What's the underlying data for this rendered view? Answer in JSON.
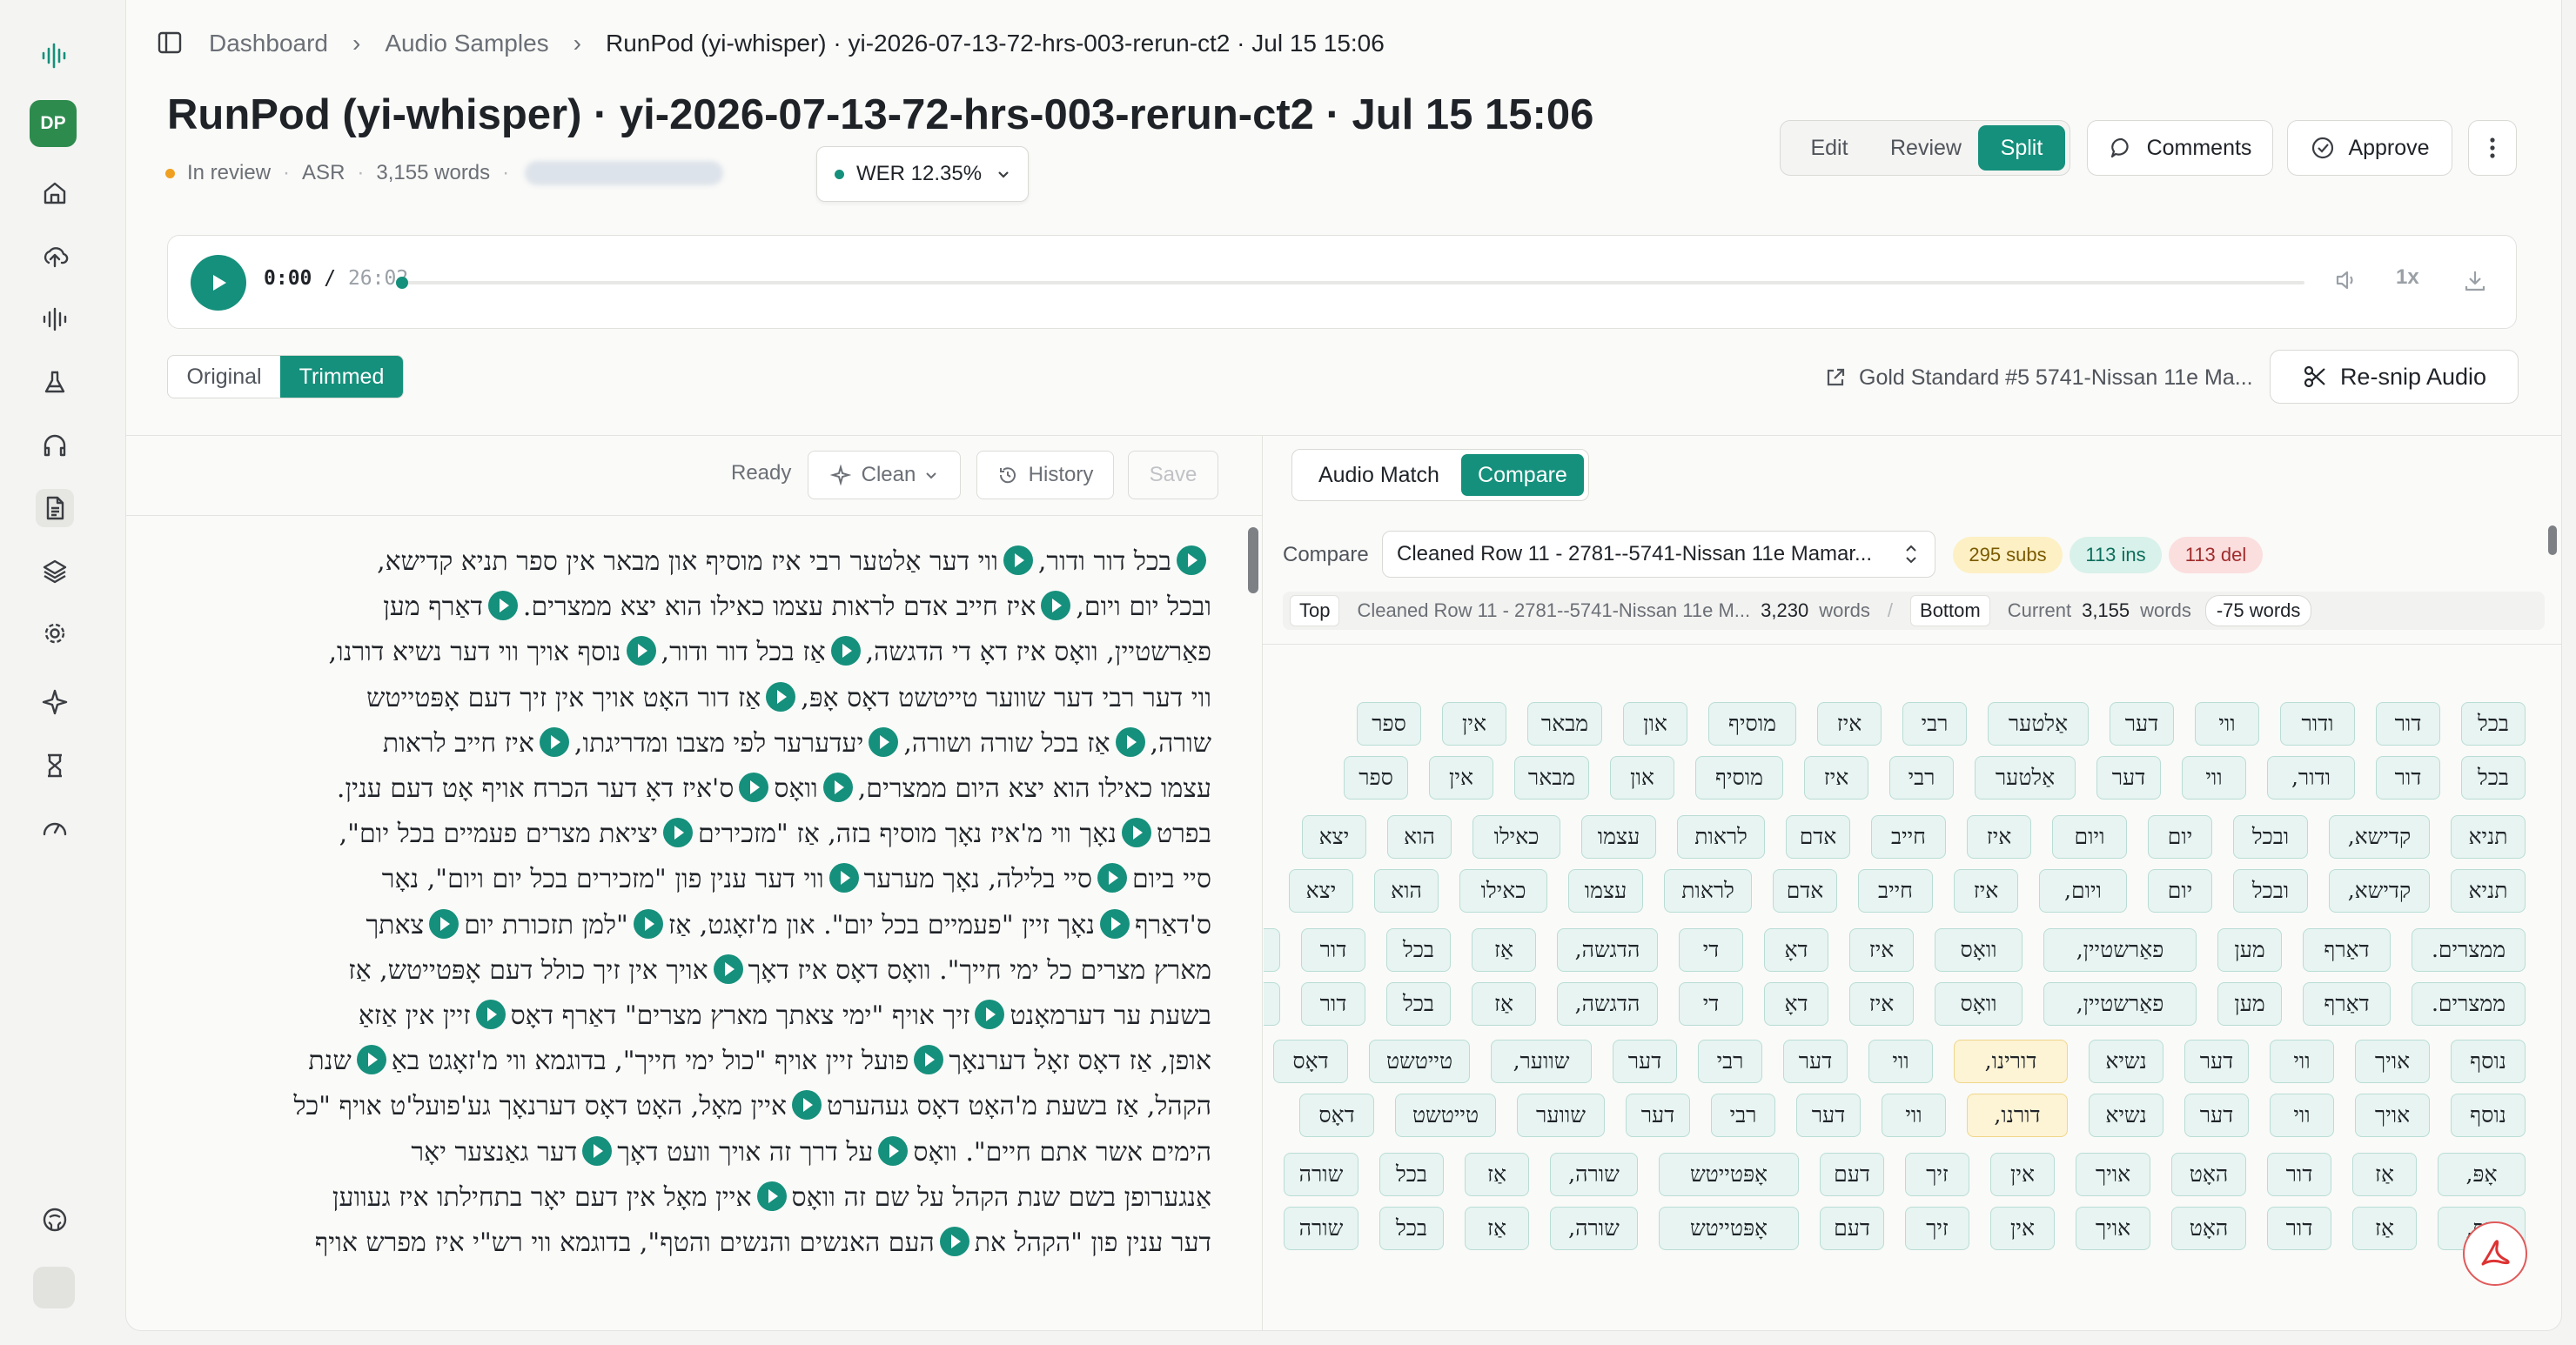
{
  "breadcrumbs": [
    "Dashboard",
    "Audio Samples",
    "RunPod (yi-whisper) · yi-2026-07-13-72-hrs-003-rerun-ct2 · Jul 15 15:06"
  ],
  "title": "RunPod (yi-whisper) · yi-2026-07-13-72-hrs-003-rerun-ct2 · Jul 15 15:06",
  "meta": {
    "status": "In review",
    "type": "ASR",
    "words": "3,155 words",
    "status_color": "#f0a020"
  },
  "wer": {
    "label": "WER 12.35%"
  },
  "modes": [
    "Edit",
    "Review",
    "Split"
  ],
  "active_mode": "Split",
  "header_buttons": {
    "comments": "Comments",
    "approve": "Approve"
  },
  "player": {
    "current": "0:00",
    "duration": "26:02",
    "speed": "1x"
  },
  "version_tabs": [
    "Original",
    "Trimmed"
  ],
  "active_version": "Trimmed",
  "gold_link": "Gold Standard #5 5741-Nissan 11e Ma...",
  "resnip": "Re-snip Audio",
  "editor_toolbar": {
    "status": "Ready",
    "clean": "Clean",
    "history": "History",
    "save": "Save"
  },
  "right_tabs": [
    "Audio Match",
    "Compare"
  ],
  "active_right_tab": "Compare",
  "compare": {
    "label": "Compare",
    "selected": "Cleaned Row 11 - 2781--5741-Nissan 11e Mamar...",
    "subs": "295 subs",
    "ins": "113 ins",
    "del": "113 del",
    "top_tag": "Top",
    "top_name": "Cleaned Row 11 - 2781--5741-Nissan 11e M...",
    "top_count": "3,230",
    "top_unit": "words",
    "bottom_tag": "Bottom",
    "bottom_name": "Current",
    "bottom_count": "3,155",
    "bottom_unit": "words",
    "diff": "-75 words"
  },
  "editor_lines": [
    [
      "בכל דור ודור,",
      "ווי דער אַלטער רבי איז מוסיף און מבאר אין ספר תניא קדישא,"
    ],
    [
      "ובכל יום ויום,",
      "איז חייב אדם לראות עצמו כאילו הוא יצא ממצרים.",
      "דאַרף מען"
    ],
    [
      "פאַרשטיין, וואָס איז דאָ די הדגשה,",
      "אַז בכל דור ודור,",
      "נוסף אויך ווי דער נשיא דורנו,"
    ],
    [
      "ווי דער רבי דער שווער טייטשט דאָס אָפּ,",
      "אַז דור האָט אויך אין זיך דעם אָפּטייטש"
    ],
    [
      "שורה,",
      "אַז בכל שורה ושורה,",
      "יעדערער לפי מצבו ומדריגתו,",
      "איז חייב לראות"
    ],
    [
      "עצמו כאילו הוא יצא היום ממצרים,",
      "וואָס",
      "ס'איז דאָ דער הכרח אויף אָט דעם ענין."
    ],
    [
      "בפרט",
      "נאָך ווי מ'איז נאָך מוסיף בזה, אַז \"מזכירים",
      "יציאת מצרים פעמיים בכל יום\","
    ],
    [
      "סיי ביום",
      "סיי בלילה, נאָך מערער",
      "ווי דער ענין פון \"מזכירים בכל יום ויום\", נאָר"
    ],
    [
      "ס'דאַרף",
      "נאָך זיין \"פעמיים בכל יום\". און מ'זאָגט, אַז",
      "\"למן תזכורת יום",
      "צאתך"
    ],
    [
      "מארץ מצרים כל ימי חייך\". וואָס דאָס איז דאָך",
      "אויך אין זיך כולל דעם אָפּטייטש, אַז"
    ],
    [
      "בשעת ער דערמאָנט",
      "זיך אויף \"ימי צאתך מארץ מצרים\" דאַרף דאָס",
      "זיין אין אַזאַ"
    ],
    [
      "אופן, אַז דאָס זאָל דערנאָך",
      "פועל זיין אויף \"כול ימי חייך\", בדוגמא ווי מ'זאָגט באַ",
      "שנת"
    ],
    [
      "הקהל, אַז בשעת מ'האָט דאָס געהערט",
      "איין מאָל, האָט דאָס דערנאָך גע'פועל'ט אויף \"כל"
    ],
    [
      "הימים אשר אתם חיים\". וואָס",
      "על דרך זה אויך וועט דאָך",
      "דער גאַנצער יאָר"
    ],
    [
      "אַנגערופן בשם שנת הקהל על שם זה וואָס",
      "איין מאָל אין דעם יאָר בתחילתו איז געווען"
    ],
    [
      "דער ענין פון \"הקהל את",
      "העם האנשים והנשים והטף\", בדוגמא ווי רש\"י איז מפרש אויף"
    ]
  ],
  "compare_rows": [
    {
      "top": [
        "בכל",
        "דור",
        "ודור",
        "ווי",
        "דער",
        "אַלטער",
        "רבי",
        "איז",
        "מוסיף",
        "און",
        "מבאר",
        "אין",
        "ספר"
      ],
      "bottom": [
        "בכל",
        "דור",
        "ודור,",
        "ווי",
        "דער",
        "אַלטער",
        "רבי",
        "איז",
        "מוסיף",
        "און",
        "מבאר",
        "אין",
        "ספר"
      ]
    },
    {
      "top": [
        "תניא",
        "קדישא,",
        "ובכל",
        "יום",
        "ויום",
        "איז",
        "חייב",
        "אדם",
        "לראות",
        "עצמו",
        "כאילו",
        "הוא",
        "יצא"
      ],
      "bottom": [
        "תניא",
        "קדישא,",
        "ובכל",
        "יום",
        "ויום,",
        "איז",
        "חייב",
        "אדם",
        "לראות",
        "עצמו",
        "כאילו",
        "הוא",
        "יצא"
      ]
    },
    {
      "top": [
        "ממצרים.",
        "דאַרף",
        "מען",
        "פאַרשטיין,",
        "וואָס",
        "איז",
        "דאָ",
        "די",
        "הדגשה,",
        "אַז",
        "בכל",
        "דור",
        "ודור,"
      ],
      "bottom": [
        "ממצרים.",
        "דאַרף",
        "מען",
        "פאַרשטיין,",
        "וואָס",
        "איז",
        "דאָ",
        "די",
        "הדגשה,",
        "אַז",
        "בכל",
        "דור",
        "ודור,"
      ]
    },
    {
      "top": [
        "נוסף",
        "אויך",
        "ווי",
        "דער",
        "נשיא",
        "דורינו,",
        "ווי",
        "דער",
        "רבי",
        "דער",
        "שווער,",
        "טייטשט",
        "דאָס"
      ],
      "bottom": [
        "נוסף",
        "אויך",
        "ווי",
        "דער",
        "נשיא",
        "דורנו,",
        "ווי",
        "דער",
        "רבי",
        "דער",
        "שווער",
        "טייטשט",
        "דאָס"
      ]
    },
    {
      "top": [
        "אָפּ,",
        "אַז",
        "דור",
        "האָט",
        "אויך",
        "אין",
        "זיך",
        "דעם",
        "אָפּטייטש",
        "שורה,",
        "אַז",
        "בכל",
        "שורה"
      ],
      "bottom": [
        "אָפּ,",
        "אַז",
        "דור",
        "האָט",
        "אויך",
        "אין",
        "זיך",
        "דעם",
        "אָפּטייטש",
        "שורה,",
        "אַז",
        "בכל",
        "שורה"
      ]
    }
  ]
}
